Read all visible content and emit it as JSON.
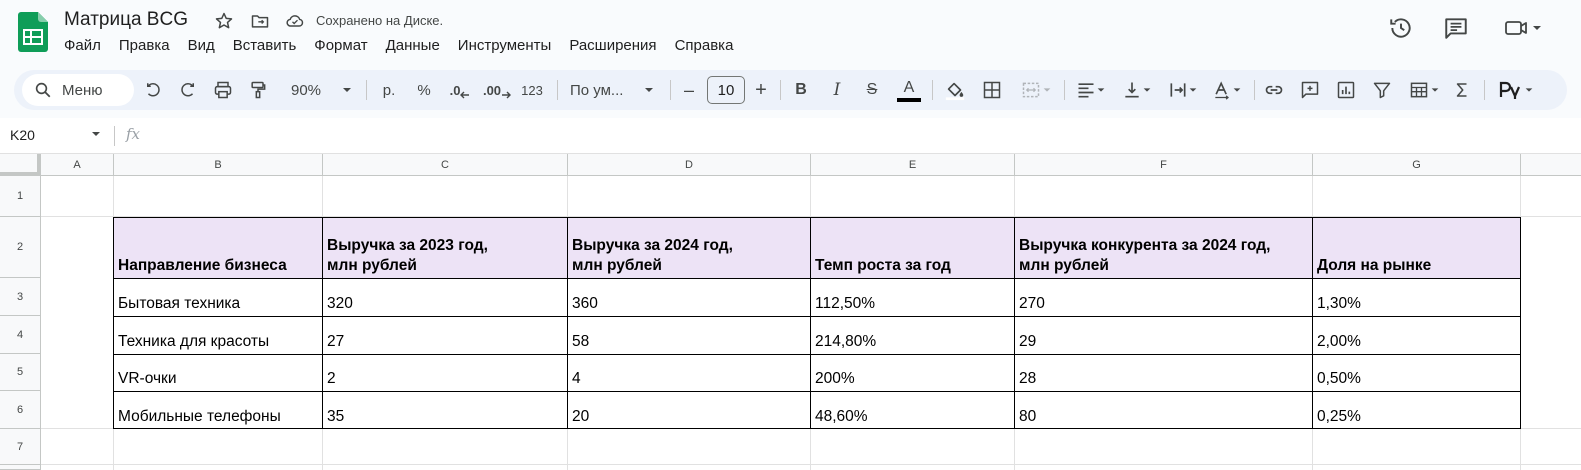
{
  "app": {
    "title": "Матрица BCG",
    "saved_status": "Сохранено на Диске."
  },
  "menu": [
    "Файл",
    "Правка",
    "Вид",
    "Вставить",
    "Формат",
    "Данные",
    "Инструменты",
    "Расширения",
    "Справка"
  ],
  "toolbar": {
    "search_label": "Меню",
    "zoom": "90%",
    "currency": "р.",
    "percent": "%",
    "decrease_decimal": ".0",
    "increase_decimal": ".00",
    "number_format": "123",
    "font": "По ум...",
    "font_size": "10",
    "minus": "–",
    "plus": "+",
    "bold": "B",
    "italic": "I",
    "strike": "S",
    "text_color": "A",
    "text_color_value": "#000000"
  },
  "formula_bar": {
    "cell_ref": "K20",
    "fx": "fx"
  },
  "columns": [
    "A",
    "B",
    "C",
    "D",
    "E",
    "F",
    "G"
  ],
  "rows": [
    "1",
    "2",
    "3",
    "4",
    "5",
    "6",
    "7"
  ],
  "table": {
    "headers": [
      "Направление бизнеса",
      "Выручка за 2023 год,\nмлн рублей",
      "Выручка за 2024 год,\nмлн рублей",
      "Темп роста за год",
      "Выручка конкурента за 2024 год,\nмлн рублей",
      "Доля на рынке"
    ],
    "header_lines": [
      [
        "",
        "Направление бизнеса"
      ],
      [
        "Выручка за 2023 год,",
        "млн рублей"
      ],
      [
        "Выручка за 2024 год,",
        "млн рублей"
      ],
      [
        "",
        "Темп роста за год"
      ],
      [
        "Выручка конкурента за 2024 год,",
        "млн рублей"
      ],
      [
        "",
        "Доля на рынке"
      ]
    ],
    "rows": [
      [
        "Бытовая техника",
        "320",
        "360",
        "112,50%",
        "270",
        "1,30%"
      ],
      [
        "Техника для красоты",
        "27",
        "58",
        "214,80%",
        "29",
        "2,00%"
      ],
      [
        "VR-очки",
        "2",
        "4",
        "200%",
        "28",
        "0,50%"
      ],
      [
        "Мобильные телефоны",
        "35",
        "20",
        "48,60%",
        "80",
        "0,25%"
      ]
    ]
  },
  "colors": {
    "header_fill": "#ede3f6",
    "sheets_green": "#0f9d58",
    "toolbar_bg": "#edf2fa"
  }
}
